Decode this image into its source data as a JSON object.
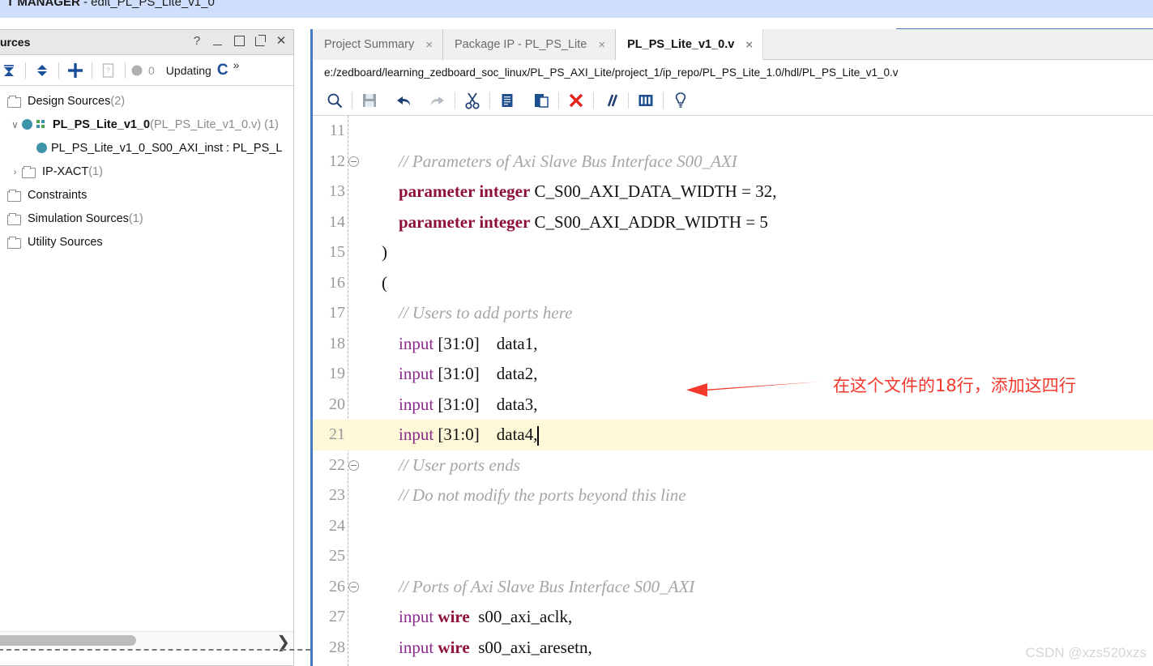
{
  "window": {
    "title_main": "T MANAGER",
    "title_sub": " - edit_PL_PS_Lite_v1_0"
  },
  "sources_panel": {
    "title": "urces",
    "header_buttons": [
      {
        "name": "help-icon",
        "label": "?"
      },
      {
        "name": "minimize-icon",
        "label": ""
      },
      {
        "name": "maximize-icon",
        "label": ""
      },
      {
        "name": "float-icon",
        "label": ""
      },
      {
        "name": "close-icon",
        "label": "✕"
      }
    ],
    "toolbar": {
      "collapse_all": "collapse-all-icon",
      "expand_all": "expand-all-icon",
      "add_sources": "plus-icon",
      "report": "report-icon",
      "status_count": "0",
      "updating_label": "Updating",
      "refresh_label": "C",
      "more_label": "»"
    },
    "tree": [
      {
        "indent": 0,
        "twisty": "",
        "icon": "folder",
        "label": "Design Sources",
        "label_bold": false,
        "dim": "(2)"
      },
      {
        "indent": 1,
        "twisty": "∨",
        "icon": "module",
        "label": "PL_PS_Lite_v1_0",
        "label_bold": true,
        "dim": "(PL_PS_Lite_v1_0.v) (1)"
      },
      {
        "indent": 2,
        "twisty": "",
        "icon": "dot",
        "label": "PL_PS_Lite_v1_0_S00_AXI_inst : PL_PS_L",
        "label_bold": false,
        "dim": ""
      },
      {
        "indent": 1,
        "twisty": "›",
        "icon": "folder",
        "label": "IP-XACT",
        "label_bold": false,
        "dim": "(1)"
      },
      {
        "indent": 0,
        "twisty": "",
        "icon": "folder",
        "label": "Constraints",
        "label_bold": false,
        "dim": ""
      },
      {
        "indent": 0,
        "twisty": "",
        "icon": "folder",
        "label": "Simulation Sources",
        "label_bold": false,
        "dim": "(1)"
      },
      {
        "indent": 0,
        "twisty": "",
        "icon": "folder",
        "label": "Utility Sources",
        "label_bold": false,
        "dim": ""
      }
    ],
    "scroll_arrow": "❯"
  },
  "editor": {
    "tabs": [
      {
        "label": "Project Summary",
        "active": false,
        "close": "×"
      },
      {
        "label": "Package IP - PL_PS_Lite",
        "active": false,
        "close": "×"
      },
      {
        "label": "PL_PS_Lite_v1_0.v",
        "active": true,
        "close": "×"
      }
    ],
    "path": "e:/zedboard/learning_zedboard_soc_linux/PL_PS_AXI_Lite/project_1/ip_repo/PL_PS_Lite_1.0/hdl/PL_PS_Lite_v1_0.v",
    "toolbar_icons": [
      "search-icon",
      "save-icon",
      "undo-icon",
      "redo-icon",
      "cut-icon",
      "copy-icon",
      "paste-icon",
      "delete-icon",
      "comment-icon",
      "columns-icon",
      "lightbulb-icon"
    ],
    "code_lines": [
      {
        "no": "11",
        "fold": false,
        "highlight": false,
        "tokens": [
          {
            "t": "",
            "c": "plain"
          }
        ]
      },
      {
        "no": "12",
        "fold": true,
        "highlight": false,
        "tokens": [
          {
            "t": "        ",
            "c": "plain"
          },
          {
            "t": "// Parameters of Axi Slave Bus Interface S00_AXI",
            "c": "cmt"
          }
        ]
      },
      {
        "no": "13",
        "fold": false,
        "highlight": false,
        "tokens": [
          {
            "t": "        ",
            "c": "plain"
          },
          {
            "t": "parameter integer",
            "c": "kw"
          },
          {
            "t": " C_S00_AXI_DATA_WIDTH = 32,",
            "c": "plain"
          }
        ]
      },
      {
        "no": "14",
        "fold": false,
        "highlight": false,
        "tokens": [
          {
            "t": "        ",
            "c": "plain"
          },
          {
            "t": "parameter integer",
            "c": "kw"
          },
          {
            "t": " C_S00_AXI_ADDR_WIDTH = 5",
            "c": "plain"
          }
        ]
      },
      {
        "no": "15",
        "fold": false,
        "highlight": false,
        "tokens": [
          {
            "t": "    )",
            "c": "plain"
          }
        ]
      },
      {
        "no": "16",
        "fold": false,
        "highlight": false,
        "tokens": [
          {
            "t": "    (",
            "c": "plain"
          }
        ]
      },
      {
        "no": "17",
        "fold": false,
        "highlight": false,
        "tokens": [
          {
            "t": "        ",
            "c": "plain"
          },
          {
            "t": "// Users to add ports here",
            "c": "cmt"
          }
        ]
      },
      {
        "no": "18",
        "fold": false,
        "highlight": false,
        "tokens": [
          {
            "t": "        ",
            "c": "plain"
          },
          {
            "t": "input",
            "c": "kw2"
          },
          {
            "t": " [31:0]    data1,",
            "c": "plain"
          }
        ]
      },
      {
        "no": "19",
        "fold": false,
        "highlight": false,
        "tokens": [
          {
            "t": "        ",
            "c": "plain"
          },
          {
            "t": "input",
            "c": "kw2"
          },
          {
            "t": " [31:0]    data2,",
            "c": "plain"
          }
        ]
      },
      {
        "no": "20",
        "fold": false,
        "highlight": false,
        "tokens": [
          {
            "t": "        ",
            "c": "plain"
          },
          {
            "t": "input",
            "c": "kw2"
          },
          {
            "t": " [31:0]    data3,",
            "c": "plain"
          }
        ]
      },
      {
        "no": "21",
        "fold": false,
        "highlight": true,
        "caret": true,
        "tokens": [
          {
            "t": "        ",
            "c": "plain"
          },
          {
            "t": "input",
            "c": "kw2"
          },
          {
            "t": " [31:0]    data4,",
            "c": "plain"
          }
        ]
      },
      {
        "no": "22",
        "fold": true,
        "highlight": false,
        "tokens": [
          {
            "t": "        ",
            "c": "plain"
          },
          {
            "t": "// User ports ends",
            "c": "cmt"
          }
        ]
      },
      {
        "no": "23",
        "fold": false,
        "highlight": false,
        "tokens": [
          {
            "t": "        ",
            "c": "plain"
          },
          {
            "t": "// Do not modify the ports beyond this line",
            "c": "cmt"
          }
        ]
      },
      {
        "no": "24",
        "fold": false,
        "highlight": false,
        "tokens": [
          {
            "t": "",
            "c": "plain"
          }
        ]
      },
      {
        "no": "25",
        "fold": false,
        "highlight": false,
        "tokens": [
          {
            "t": "",
            "c": "plain"
          }
        ]
      },
      {
        "no": "26",
        "fold": true,
        "highlight": false,
        "tokens": [
          {
            "t": "        ",
            "c": "plain"
          },
          {
            "t": "// Ports of Axi Slave Bus Interface S00_AXI",
            "c": "cmt"
          }
        ]
      },
      {
        "no": "27",
        "fold": false,
        "highlight": false,
        "tokens": [
          {
            "t": "        ",
            "c": "plain"
          },
          {
            "t": "input ",
            "c": "kw2"
          },
          {
            "t": "wire",
            "c": "kw"
          },
          {
            "t": "  s00_axi_aclk,",
            "c": "plain"
          }
        ]
      },
      {
        "no": "28",
        "fold": false,
        "highlight": false,
        "tokens": [
          {
            "t": "        ",
            "c": "plain"
          },
          {
            "t": "input ",
            "c": "kw2"
          },
          {
            "t": "wire",
            "c": "kw"
          },
          {
            "t": "  s00_axi_aresetn,",
            "c": "plain"
          }
        ]
      }
    ]
  },
  "annotation": {
    "text": "在这个文件的18行，添加这四行",
    "arrow_color": "#f2392c"
  },
  "watermark": "CSDN @xzs520xzs",
  "colors": {
    "title_bar": "#cfdffb",
    "accent_blue": "#4478c8",
    "keyword": "#8e1038",
    "keyword2": "#8c2a8c",
    "comment": "#a5a5a5",
    "highlight_line": "#fcf8d8",
    "tree_dot": "#3d93a8"
  }
}
